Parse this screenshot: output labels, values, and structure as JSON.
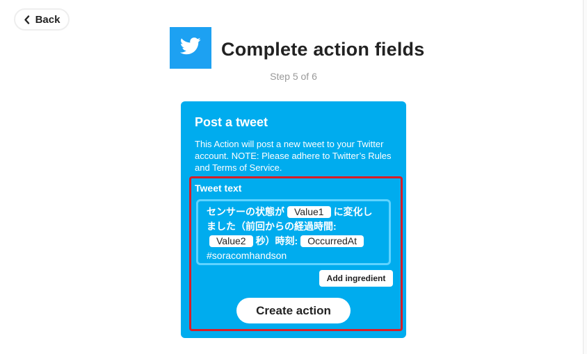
{
  "header": {
    "back_label": "Back",
    "title": "Complete action fields",
    "step": "Step 5 of 6"
  },
  "service": {
    "name": "Twitter",
    "icon": "twitter-bird-icon",
    "brand_color": "#1da1f2"
  },
  "card": {
    "background": "#00acee",
    "title": "Post a tweet",
    "description": "This Action will post a new tweet to your Twitter account. NOTE: Please adhere to Twitter’s Rules and Terms of Service.",
    "field_label": "Tweet text",
    "tweet": {
      "text_1": "センサーの状態が",
      "ingredient_1": "Value1",
      "text_2": "に変化しました（前回からの経過時間:",
      "ingredient_2": "Value2",
      "text_3": "秒）時刻:",
      "ingredient_3": "OccurredAt",
      "text_4": "#soracomhandson"
    },
    "add_ingredient_label": "Add ingredient",
    "create_action_label": "Create action"
  },
  "annotation": {
    "highlight_color": "#d81e27"
  }
}
